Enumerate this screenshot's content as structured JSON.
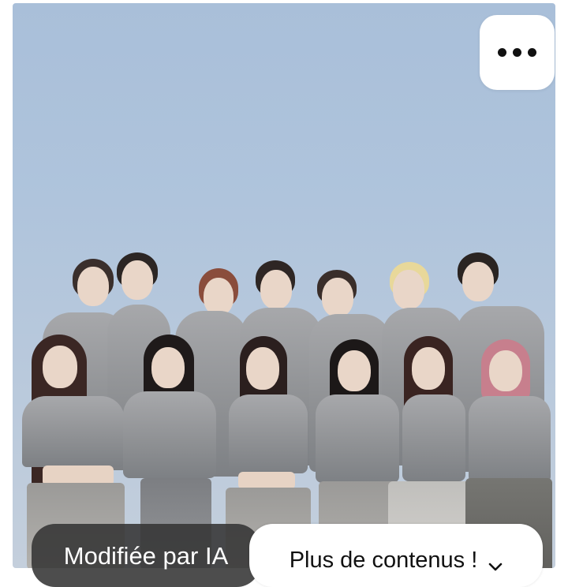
{
  "photo": {
    "description_icon": "photo-icon"
  },
  "more_button": {
    "icon": "more-horizontal-icon"
  },
  "ai_badge": {
    "label": "Modifiée par IA"
  },
  "more_content": {
    "label": "Plus de contenus !",
    "icon": "chevron-down-icon"
  },
  "colors": {
    "sky": "#afc4dc",
    "badge_bg": "#343434",
    "button_bg": "#ffffff",
    "text_dark": "#111111"
  }
}
